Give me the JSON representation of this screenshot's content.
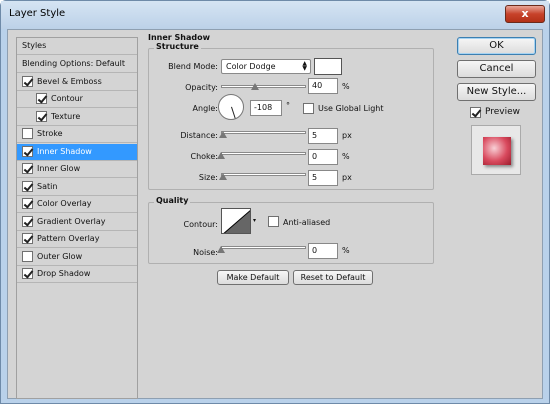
{
  "window": {
    "title": "Layer Style",
    "close_glyph": "x"
  },
  "styles_list": {
    "header": "Styles",
    "items": [
      {
        "label": "Blending Options: Default",
        "checkbox": false,
        "checked": false,
        "indent": 0,
        "selected": false
      },
      {
        "label": "Bevel & Emboss",
        "checkbox": true,
        "checked": true,
        "indent": 0,
        "selected": false
      },
      {
        "label": "Contour",
        "checkbox": true,
        "checked": true,
        "indent": 1,
        "selected": false
      },
      {
        "label": "Texture",
        "checkbox": true,
        "checked": true,
        "indent": 1,
        "selected": false
      },
      {
        "label": "Stroke",
        "checkbox": true,
        "checked": false,
        "indent": 0,
        "selected": false
      },
      {
        "label": "Inner Shadow",
        "checkbox": true,
        "checked": true,
        "indent": 0,
        "selected": true
      },
      {
        "label": "Inner Glow",
        "checkbox": true,
        "checked": true,
        "indent": 0,
        "selected": false
      },
      {
        "label": "Satin",
        "checkbox": true,
        "checked": true,
        "indent": 0,
        "selected": false
      },
      {
        "label": "Color Overlay",
        "checkbox": true,
        "checked": true,
        "indent": 0,
        "selected": false
      },
      {
        "label": "Gradient Overlay",
        "checkbox": true,
        "checked": true,
        "indent": 0,
        "selected": false
      },
      {
        "label": "Pattern Overlay",
        "checkbox": true,
        "checked": true,
        "indent": 0,
        "selected": false
      },
      {
        "label": "Outer Glow",
        "checkbox": true,
        "checked": false,
        "indent": 0,
        "selected": false
      },
      {
        "label": "Drop Shadow",
        "checkbox": true,
        "checked": true,
        "indent": 0,
        "selected": false
      }
    ]
  },
  "inner_shadow": {
    "title": "Inner Shadow",
    "structure": {
      "title": "Structure",
      "blend_mode_label": "Blend Mode:",
      "blend_mode_value": "Color Dodge",
      "blend_color": "#ffffff",
      "opacity_label": "Opacity:",
      "opacity_value": "40",
      "opacity_unit": "%",
      "opacity_fraction": 0.4,
      "angle_label": "Angle:",
      "angle_value": "-108",
      "angle_unit": "°",
      "use_global_light_label": "Use Global Light",
      "use_global_light_checked": false,
      "distance_label": "Distance:",
      "distance_value": "5",
      "distance_unit": "px",
      "distance_fraction": 0.02,
      "choke_label": "Choke:",
      "choke_value": "0",
      "choke_unit": "%",
      "choke_fraction": 0.0,
      "size_label": "Size:",
      "size_value": "5",
      "size_unit": "px",
      "size_fraction": 0.02
    },
    "quality": {
      "title": "Quality",
      "contour_label": "Contour:",
      "anti_aliased_label": "Anti-aliased",
      "anti_aliased_checked": false,
      "noise_label": "Noise:",
      "noise_value": "0",
      "noise_unit": "%",
      "noise_fraction": 0.0
    },
    "make_default_label": "Make Default",
    "reset_default_label": "Reset to Default"
  },
  "buttons": {
    "ok": "OK",
    "cancel": "Cancel",
    "new_style": "New Style...",
    "preview_label": "Preview",
    "preview_checked": true
  },
  "colors": {
    "selection": "#3399ff",
    "dialog_bg": "#d4d4d4",
    "title_bar": "#b9d1ea",
    "close_button": "#c7422a"
  }
}
